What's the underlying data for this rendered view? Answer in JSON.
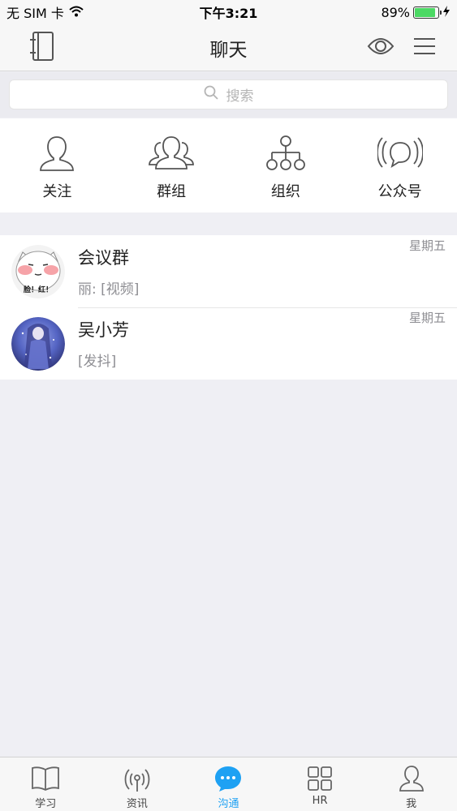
{
  "status_bar": {
    "carrier": "无 SIM 卡",
    "time": "下午3:21",
    "battery": "89%",
    "battery_level": 0.89
  },
  "nav": {
    "title": "聊天",
    "left_icon": "contacts-book-icon",
    "eye_icon": "eye-icon",
    "menu_icon": "menu-icon"
  },
  "search": {
    "placeholder": "搜索"
  },
  "quick": {
    "items": [
      {
        "label": "关注",
        "icon": "person-icon"
      },
      {
        "label": "群组",
        "icon": "group-icon"
      },
      {
        "label": "组织",
        "icon": "org-chart-icon"
      },
      {
        "label": "公众号",
        "icon": "broadcast-icon"
      }
    ]
  },
  "chats": [
    {
      "name": "会议群",
      "preview": "丽: [视频]",
      "time": "星期五",
      "avatar_text": "脸！红！"
    },
    {
      "name": "吴小芳",
      "preview": "[发抖]",
      "time": "星期五"
    }
  ],
  "tabs": [
    {
      "label": "学习",
      "icon": "book-icon"
    },
    {
      "label": "资讯",
      "icon": "antenna-icon"
    },
    {
      "label": "沟通",
      "icon": "chat-bubble-icon",
      "active": true
    },
    {
      "label": "HR",
      "icon": "grid-icon"
    },
    {
      "label": "我",
      "icon": "profile-icon"
    }
  ],
  "colors": {
    "accent": "#1ea1f3",
    "battery_green": "#4cd964",
    "background": "#efeff4"
  }
}
